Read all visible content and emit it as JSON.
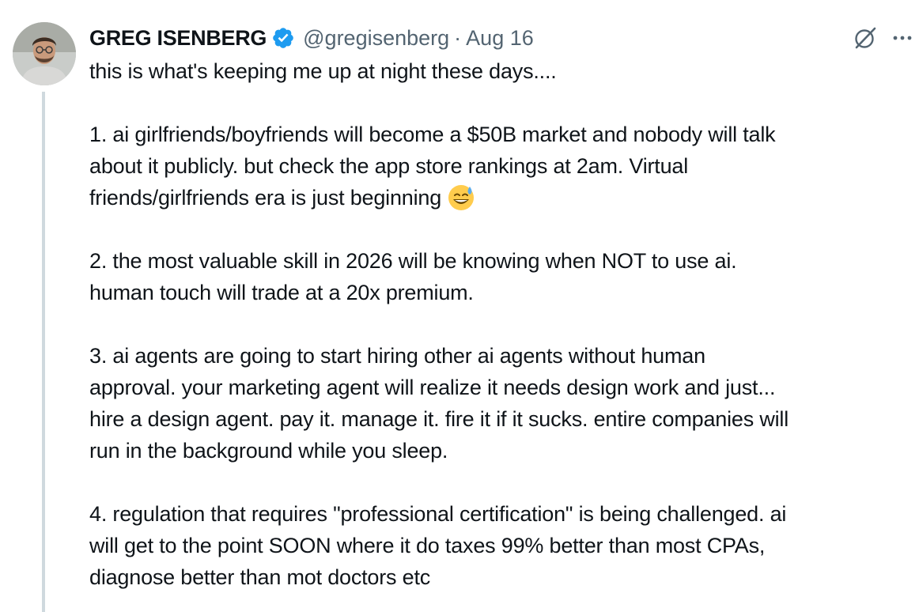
{
  "author": {
    "name": "GREG ISENBERG",
    "handle": "@gregisenberg",
    "separator": "·",
    "date": "Aug 16",
    "verified_color": "#1d9bf0"
  },
  "icons": {
    "avatar": "profile-photo",
    "verified": "verified-badge-icon",
    "grok": "grok-slash-icon",
    "more": "more-horizontal-icon",
    "emoji": "grinning-face-with-sweat"
  },
  "tweet": {
    "lines": [
      "this is what's keeping me up at night these days....",
      "",
      "1. ai girlfriends/boyfriends will become a $50B market and nobody will talk",
      "about it publicly. but check the app store rankings at 2am. Virtual",
      "friends/girlfriends era is just beginning",
      "",
      "2. the most valuable skill in 2026 will be knowing when NOT to use ai.",
      "human touch will trade at a 20x premium.",
      "",
      "3. ai agents are going to start hiring other ai agents without human",
      "approval. your marketing agent will realize it needs design work and just...",
      "hire a design agent. pay it. manage it. fire it if it sucks. entire companies will",
      "run in the background while you sleep.",
      "",
      "4. regulation that requires \"professional certification\" is being challenged. ai",
      "will get to the point SOON where it do taxes 99% better than most CPAs,",
      "diagnose better than mot doctors etc"
    ]
  },
  "colors": {
    "text": "#0f1419",
    "secondary": "#536471",
    "thread_line": "#cfd9de",
    "accent": "#1d9bf0"
  }
}
